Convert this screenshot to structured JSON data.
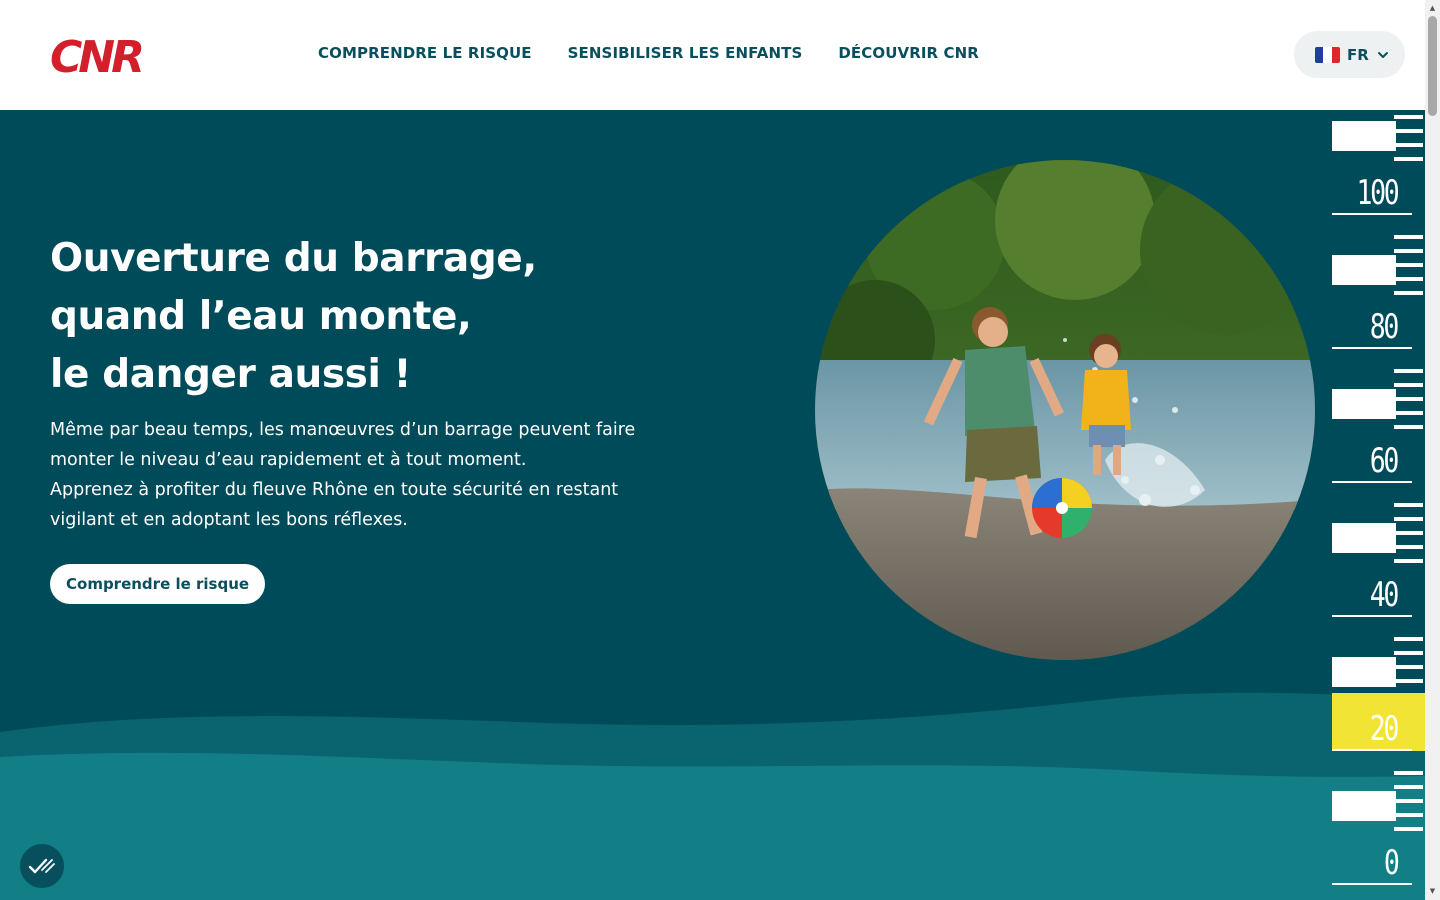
{
  "header": {
    "logo_text": "CNR",
    "nav": [
      {
        "label": "COMPRENDRE LE RISQUE"
      },
      {
        "label": "SENSIBILISER LES ENFANTS"
      },
      {
        "label": "DÉCOUVRIR CNR"
      }
    ],
    "language": {
      "code": "FR",
      "flag_icon": "france-flag-icon"
    }
  },
  "hero": {
    "title_lines": [
      "Ouverture du barrage,",
      "quand l’eau monte,",
      "le danger aussi !"
    ],
    "text_lines": [
      "Même par beau temps, les manœuvres d’un barrage peuvent faire",
      "monter le niveau d’eau rapidement et à tout moment.",
      "Apprenez à profiter du fleuve Rhône en toute sécurité en restant",
      "vigilant et en adoptant les bons réflexes."
    ],
    "cta_label": "Comprendre le risque",
    "image_icon": "children-playing-in-river-photo"
  },
  "gauge": {
    "labels": [
      "100",
      "80",
      "60",
      "40",
      "20",
      "0"
    ],
    "highlight_value": 20,
    "highlight_color": "#f2e435"
  },
  "accessibility_button": {
    "icon": "accessibility-check-icon"
  },
  "colors": {
    "brand_red": "#d21f2b",
    "dark_teal": "#004b5a",
    "mid_teal": "#0a6470",
    "light_teal": "#127f86",
    "text_teal": "#0b4f5e"
  }
}
